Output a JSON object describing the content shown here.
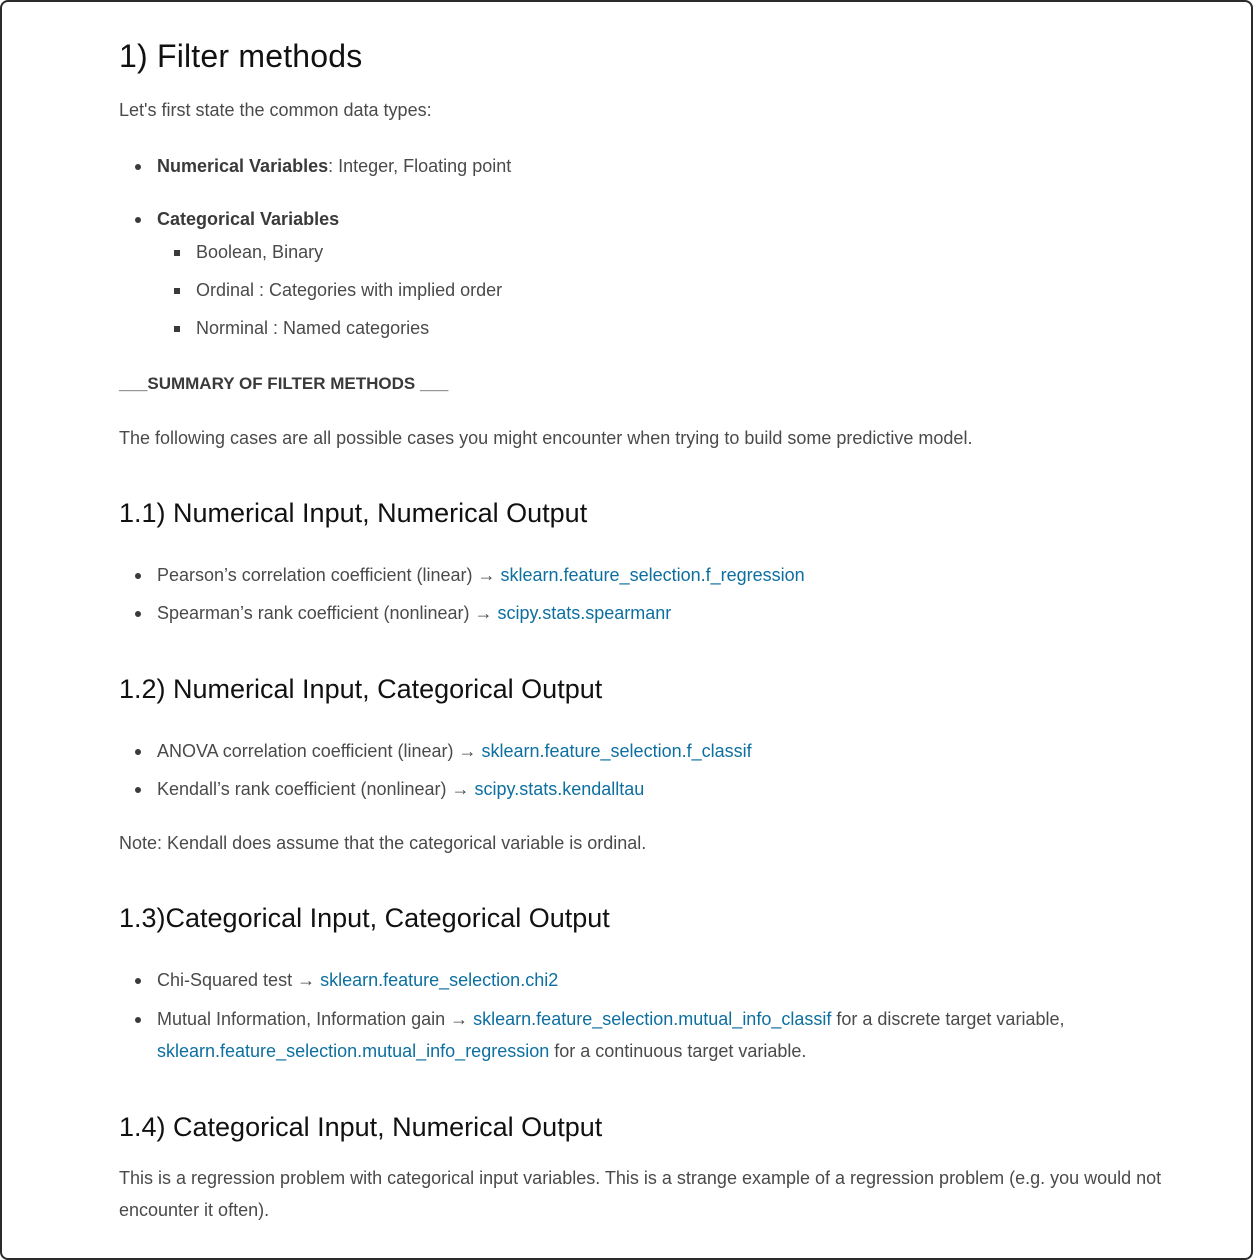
{
  "title": "1) Filter methods",
  "intro": "Let's first state the common data types:",
  "data_types": {
    "numerical_label": "Numerical Variables",
    "numerical_rest": ": Integer, Floating point",
    "categorical_label": "Categorical Variables",
    "categorical_items": [
      "Boolean, Binary",
      "Ordinal : Categories with implied order",
      "Norminal : Named categories"
    ]
  },
  "summary_heading": "___SUMMARY OF FILTER METHODS ___",
  "summary_text": "The following cases are all possible cases you might encounter when trying to build some predictive model.",
  "s11": {
    "heading": "1.1) Numerical Input, Numerical Output",
    "i1_text": "Pearson’s correlation coefficient (linear) → ",
    "i1_link": "sklearn.feature_selection.f_regression",
    "i2_text": "Spearman’s rank coefficient (nonlinear) → ",
    "i2_link": "scipy.stats.spearmanr"
  },
  "s12": {
    "heading": "1.2) Numerical Input, Categorical Output",
    "i1_text": "ANOVA correlation coefficient (linear) → ",
    "i1_link": "sklearn.feature_selection.f_classif",
    "i2_text": "Kendall’s rank coefficient (nonlinear) → ",
    "i2_link": "scipy.stats.kendalltau",
    "note": "Note: Kendall does assume that the categorical variable is ordinal."
  },
  "s13": {
    "heading": "1.3)Categorical Input, Categorical Output",
    "i1_text": "Chi-Squared test → ",
    "i1_link": "sklearn.feature_selection.chi2",
    "i2_text": "Mutual Information, Information gain → ",
    "i2_link1": "sklearn.feature_selection.mutual_info_classif",
    "i2_mid": " for a discrete target variable,",
    "i2_link2": "sklearn.feature_selection.mutual_info_regression",
    "i2_end": " for a continuous target variable."
  },
  "s14": {
    "heading": "1.4) Categorical Input, Numerical Output",
    "text": "This is a regression problem with categorical input variables. This is a strange example of a regression problem (e.g. you would not encounter it often)."
  }
}
